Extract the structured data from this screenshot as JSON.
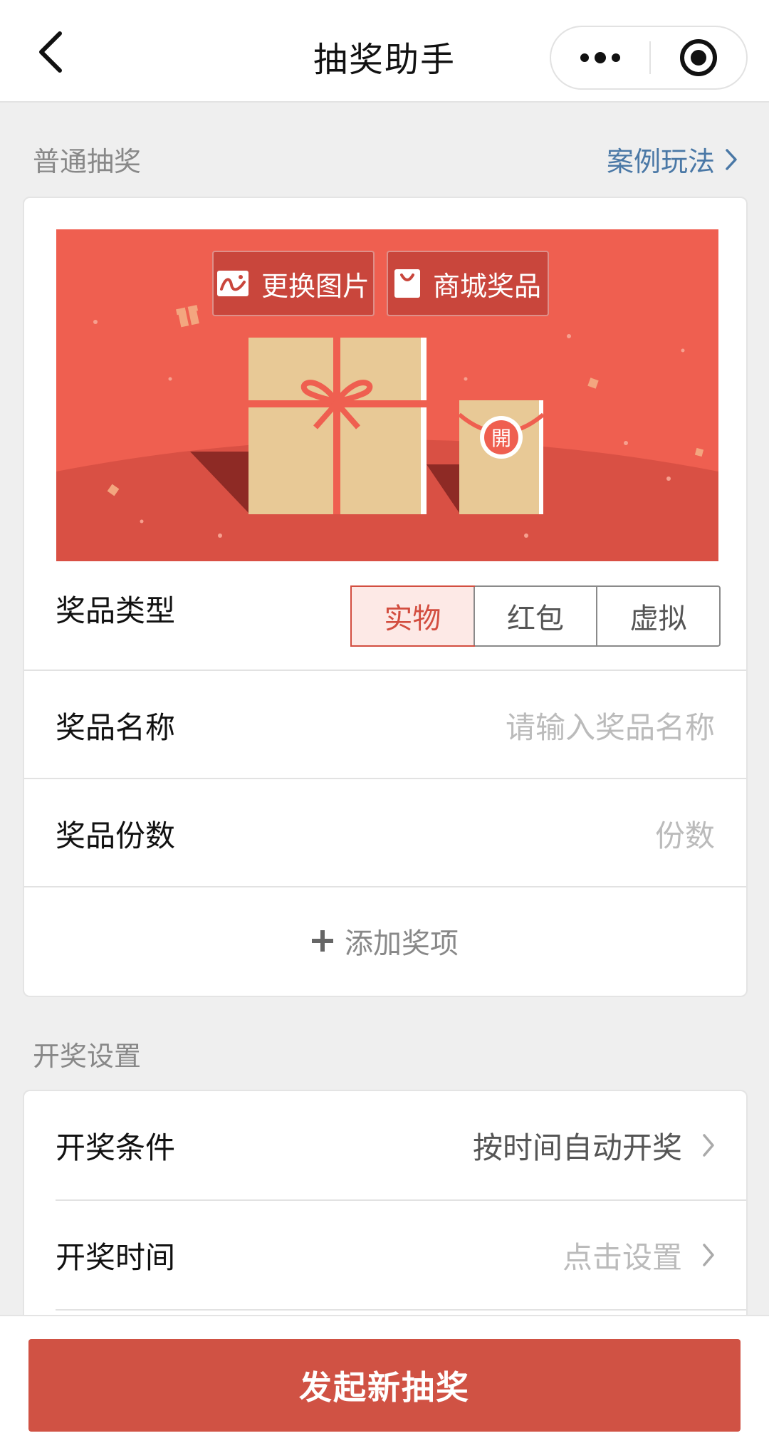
{
  "header": {
    "title": "抽奖助手"
  },
  "prize_section": {
    "label": "普通抽奖",
    "link": "案例玩法"
  },
  "banner": {
    "change_image_label": "更换图片",
    "mall_prize_label": "商城奖品",
    "red_packet_char": "開",
    "colors": {
      "background": "#ef5f50",
      "hill": "#d95044",
      "box": "#e8c996",
      "ribbon": "#ef5f50"
    }
  },
  "prize_type": {
    "label": "奖品类型",
    "options": [
      "实物",
      "红包",
      "虚拟"
    ],
    "selected": "实物"
  },
  "prize_name": {
    "label": "奖品名称",
    "placeholder": "请输入奖品名称"
  },
  "prize_count": {
    "label": "奖品份数",
    "placeholder": "份数"
  },
  "add_prize": {
    "label": "添加奖项"
  },
  "draw_section": {
    "label": "开奖设置",
    "condition": {
      "label": "开奖条件",
      "value": "按时间自动开奖"
    },
    "time": {
      "label": "开奖时间",
      "value": "点击设置"
    }
  },
  "bottom": {
    "primary_label": "发起新抽奖",
    "accent": "#d05244"
  }
}
